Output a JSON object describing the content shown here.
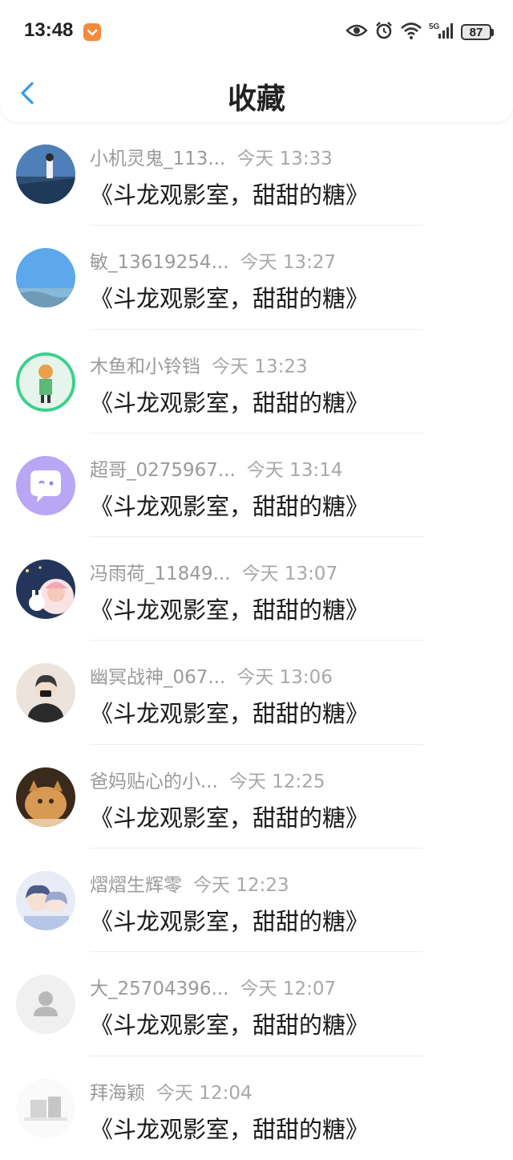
{
  "statusbar": {
    "time": "13:48",
    "battery": "87"
  },
  "header": {
    "title": "收藏"
  },
  "items": [
    {
      "name": "小机灵鬼_113...",
      "date": "今天 13:33",
      "content": "《斗龙观影室，甜甜的糖》"
    },
    {
      "name": "敏_13619254...",
      "date": "今天 13:27",
      "content": "《斗龙观影室，甜甜的糖》"
    },
    {
      "name": "木鱼和小铃铛",
      "date": "今天 13:23",
      "content": "《斗龙观影室，甜甜的糖》"
    },
    {
      "name": "超哥_0275967...",
      "date": "今天 13:14",
      "content": "《斗龙观影室，甜甜的糖》"
    },
    {
      "name": "冯雨荷_11849...",
      "date": "今天 13:07",
      "content": "《斗龙观影室，甜甜的糖》"
    },
    {
      "name": "幽冥战神_067...",
      "date": "今天 13:06",
      "content": "《斗龙观影室，甜甜的糖》"
    },
    {
      "name": "爸妈贴心的小...",
      "date": "今天 12:25",
      "content": "《斗龙观影室，甜甜的糖》"
    },
    {
      "name": "熠熠生辉零",
      "date": "今天 12:23",
      "content": "《斗龙观影室，甜甜的糖》"
    },
    {
      "name": "大_25704396...",
      "date": "今天 12:07",
      "content": "《斗龙观影室，甜甜的糖》"
    },
    {
      "name": "拜海颖",
      "date": "今天 12:04",
      "content": "《斗龙观影室，甜甜的糖》"
    }
  ]
}
